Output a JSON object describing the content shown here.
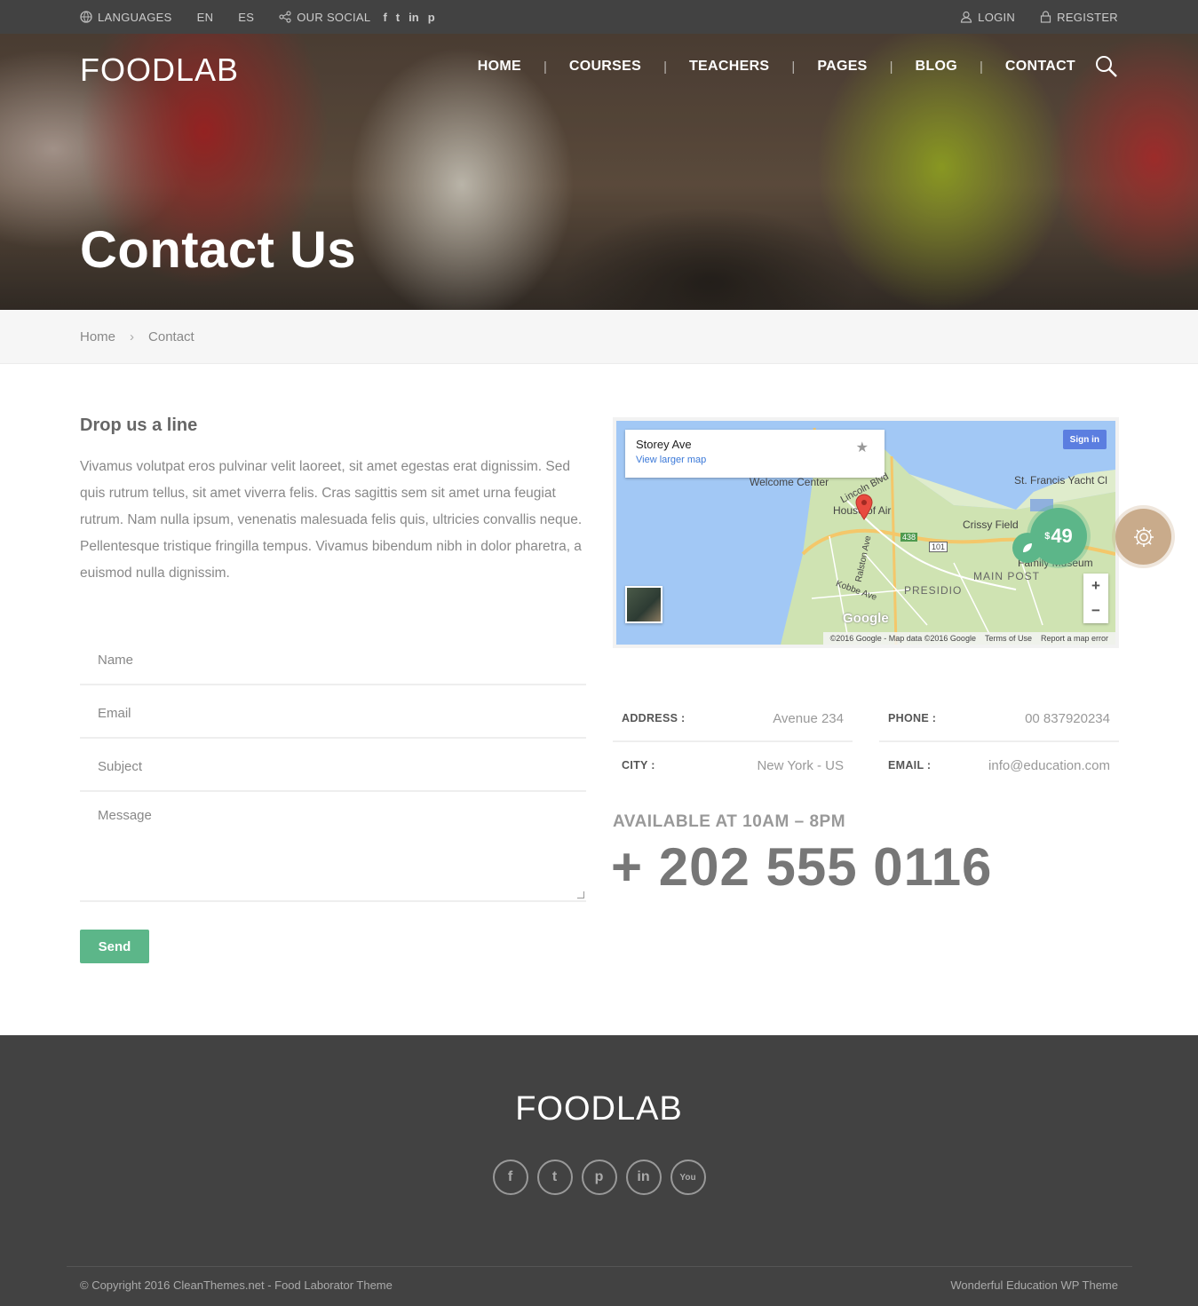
{
  "topbar": {
    "languages_label": "LANGUAGES",
    "lang_en": "EN",
    "lang_es": "ES",
    "social_label": "OUR SOCIAL",
    "social_icons": [
      "facebook-icon",
      "twitter-icon",
      "linkedin-icon",
      "pinterest-icon"
    ],
    "social_glyphs": [
      "f",
      "t",
      "in",
      "p"
    ],
    "login": "LOGIN",
    "register": "REGISTER"
  },
  "brand": {
    "logo": "FOODLAB"
  },
  "nav": {
    "items": [
      "HOME",
      "COURSES",
      "TEACHERS",
      "PAGES",
      "BLOG",
      "CONTACT"
    ],
    "separator": "|"
  },
  "hero": {
    "title": "Contact Us"
  },
  "breadcrumb": {
    "home": "Home",
    "current": "Contact",
    "separator": "›"
  },
  "form": {
    "heading": "Drop us a line",
    "intro": "Vivamus volutpat eros pulvinar velit laoreet, sit amet egestas erat dignissim. Sed quis rutrum tellus, sit amet viverra felis. Cras sagittis sem sit amet urna feugiat rutrum. Nam nulla ipsum, venenatis malesuada felis quis, ultricies convallis neque. Pellentesque tristique fringilla tempus. Vivamus bibendum nibh in dolor pharetra, a euismod nulla dignissim.",
    "name_placeholder": "Name",
    "email_placeholder": "Email",
    "subject_placeholder": "Subject",
    "message_placeholder": "Message",
    "send_label": "Send"
  },
  "map": {
    "card_title": "Storey Ave",
    "card_link": "View larger map",
    "signin": "Sign in",
    "labels": {
      "welcome": "Welcome Center",
      "lincoln": "Lincoln Blvd",
      "house": "House of Air",
      "crissy": "Crissy Field",
      "yacht": "St. Francis Yacht Cl",
      "museum": "Family Museum",
      "presidio": "PRESIDIO",
      "main_post": "MAIN POST",
      "ralston": "Ralston Ave",
      "kobbe": "Kobbe Ave",
      "route_438": "438",
      "route_101": "101"
    },
    "google": "Google",
    "footer": [
      "©2016 Google - Map data ©2016 Google",
      "Terms of Use",
      "Report a map error"
    ],
    "zoom_in": "+",
    "zoom_out": "−"
  },
  "badges": {
    "price_currency": "$",
    "price": "49"
  },
  "contact_info": {
    "address_label": "ADDRESS :",
    "address_value": "Avenue 234",
    "phone_label": "PHONE :",
    "phone_value": "00 837920234",
    "city_label": "CITY :",
    "city_value": "New York - US",
    "email_label": "EMAIL :",
    "email_value": "info@education.com"
  },
  "availability": {
    "hours": "AVAILABLE AT 10AM – 8PM",
    "phone": "+ 202 555 0116"
  },
  "footer": {
    "logo": "FOODLAB",
    "socials": [
      "facebook-icon",
      "twitter-icon",
      "pinterest-icon",
      "linkedin-icon",
      "youtube-icon"
    ],
    "social_glyphs": [
      "f",
      "t",
      "p",
      "in",
      "You"
    ],
    "copyright": "© Copyright 2016 CleanThemes.net - Food Laborator Theme",
    "right_text": "Wonderful Education WP Theme"
  },
  "colors": {
    "accent_green": "#5cb689",
    "topbar": "#424242",
    "footer": "#424242",
    "gear_badge": "#c9ab8b"
  }
}
